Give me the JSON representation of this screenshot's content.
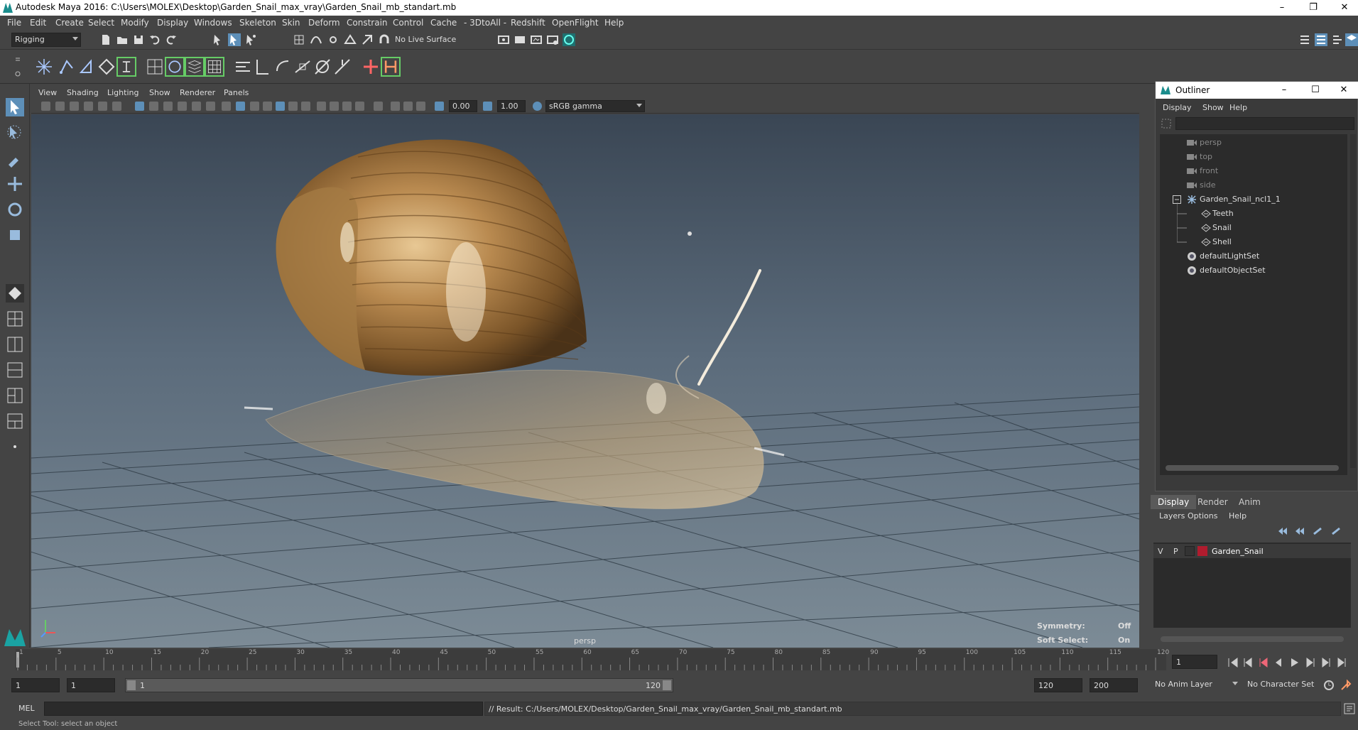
{
  "window": {
    "title": "Autodesk Maya 2016: C:\\Users\\MOLEX\\Desktop\\Garden_Snail_max_vray\\Garden_Snail_mb_standart.mb",
    "minimize": "–",
    "maximize": "❐",
    "close": "✕"
  },
  "menubar": [
    "File",
    "Edit",
    "Create",
    "Select",
    "Modify",
    "Display",
    "Windows",
    "Skeleton",
    "Skin",
    "Deform",
    "Constrain",
    "Control",
    "Cache",
    "- 3DtoAll -",
    "Redshift",
    "OpenFlight",
    "Help"
  ],
  "statusline": {
    "menuset": "Rigging",
    "live_surface": "No Live Surface"
  },
  "viewport": {
    "menus": [
      "View",
      "Shading",
      "Lighting",
      "Show",
      "Renderer",
      "Panels"
    ],
    "exposure": "0.00",
    "gamma": "1.00",
    "color_space": "sRGB gamma",
    "camera_label": "persp",
    "hud": {
      "symmetry_label": "Symmetry:",
      "symmetry_value": "Off",
      "soft_select_label": "Soft Select:",
      "soft_select_value": "On"
    }
  },
  "outliner": {
    "title": "Outliner",
    "menus": [
      "Display",
      "Show",
      "Help"
    ],
    "items": [
      {
        "label": "persp",
        "indent": 0,
        "dim": true,
        "icon": "camera-icon"
      },
      {
        "label": "top",
        "indent": 0,
        "dim": true,
        "icon": "camera-icon"
      },
      {
        "label": "front",
        "indent": 0,
        "dim": true,
        "icon": "camera-icon"
      },
      {
        "label": "side",
        "indent": 0,
        "dim": true,
        "icon": "camera-icon"
      },
      {
        "label": "Garden_Snail_ncl1_1",
        "indent": 0,
        "dim": false,
        "icon": "joint-icon"
      },
      {
        "label": "Teeth",
        "indent": 1,
        "dim": false,
        "icon": "mesh-icon"
      },
      {
        "label": "Snail",
        "indent": 1,
        "dim": false,
        "icon": "mesh-icon"
      },
      {
        "label": "Shell",
        "indent": 1,
        "dim": false,
        "icon": "mesh-icon"
      },
      {
        "label": "defaultLightSet",
        "indent": 0,
        "dim": false,
        "icon": "set-icon"
      },
      {
        "label": "defaultObjectSet",
        "indent": 0,
        "dim": false,
        "icon": "set-icon"
      }
    ]
  },
  "layers": {
    "tabs": [
      "Display",
      "Render",
      "Anim"
    ],
    "menus": [
      "Layers",
      "Options",
      "Help"
    ],
    "layer": {
      "v": "V",
      "p": "P",
      "name": "Garden_Snail",
      "color": "#b01c2e"
    }
  },
  "timeline": {
    "ticks": [
      "1",
      "5",
      "10",
      "15",
      "20",
      "25",
      "30",
      "35",
      "40",
      "45",
      "50",
      "55",
      "60",
      "65",
      "70",
      "75",
      "80",
      "85",
      "90",
      "95",
      "100",
      "105",
      "110",
      "115",
      "120"
    ],
    "current_frame": "1"
  },
  "range": {
    "start": "1",
    "playback_start": "1",
    "slider_start": "1",
    "slider_end": "120",
    "playback_end": "120",
    "end": "200",
    "anim_layer": "No Anim Layer",
    "character_set": "No Character Set"
  },
  "cmdline": {
    "lang": "MEL",
    "result": "// Result: C:/Users/MOLEX/Desktop/Garden_Snail_max_vray/Garden_Snail_mb_standart.mb"
  },
  "helpline": "Select Tool: select an object"
}
